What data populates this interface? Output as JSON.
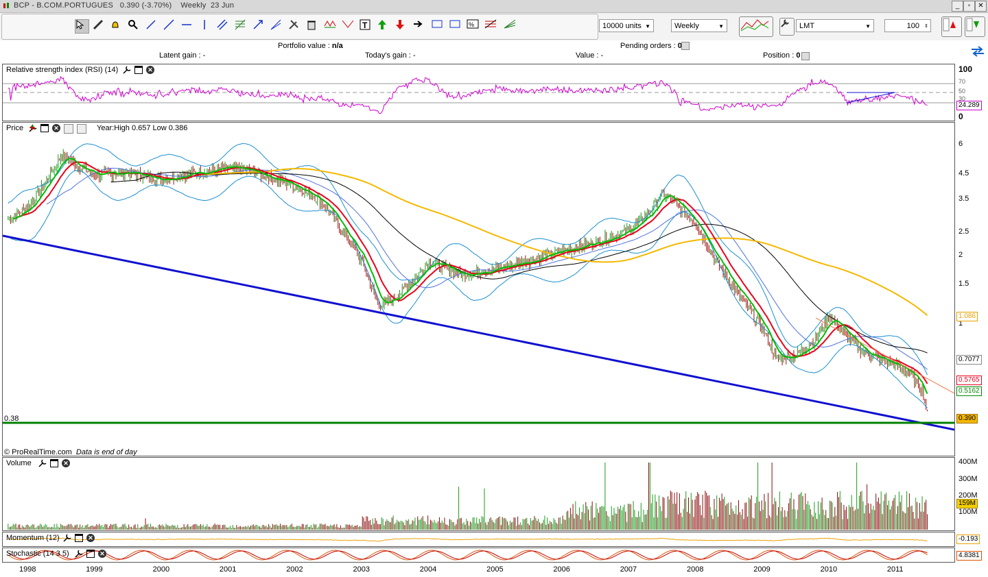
{
  "window": {
    "title": "BCP - B.COM.PORTUGUES",
    "price": "0.390",
    "change": "(-3.70%)",
    "period": "Weekly",
    "date": "23 Jun"
  },
  "toolbar": {
    "units": "10000 units",
    "timeframe": "Weekly",
    "order_type": "LMT",
    "quantity": "100"
  },
  "info": {
    "portfolio_label": "Portfolio value :",
    "portfolio_value": "n/a",
    "pending_label": "Pending orders :",
    "pending_value": "0",
    "latent_label": "Latent gain :",
    "latent_value": "-",
    "today_label": "Today's gain :",
    "today_value": "-",
    "value_label": "Value :",
    "value_value": "-",
    "position_label": "Position :",
    "position_value": "0"
  },
  "panels": {
    "rsi": {
      "title": "Relative strength index (RSI) (14)",
      "ticks": [
        "100",
        "70",
        "50",
        "30",
        "0"
      ],
      "last": "24.289"
    },
    "price": {
      "title": "Price",
      "yearinfo": "Year:High 0.657 Low 0.386",
      "ticks": [
        "6",
        "4.5",
        "3.5",
        "2.5",
        "2",
        "1.5",
        "1"
      ],
      "level_label": "0.38",
      "footer": "© ProRealTime.com",
      "footer_note": "Data is end of day",
      "tags": {
        "black_ma": "0.7077",
        "red_ma": "0.5765",
        "green_ma": "0.5162",
        "last": "0.390",
        "orange_ma": "1.086"
      }
    },
    "volume": {
      "title": "Volume",
      "ticks": [
        "400M",
        "300M",
        "200M",
        "100M"
      ],
      "last": "159M"
    },
    "momentum": {
      "title": "Momentum (12)",
      "last": "-0.193"
    },
    "stochastic": {
      "title": "Stochastic (14 3 5)",
      "last": "4.8381"
    }
  },
  "xaxis": [
    "1998",
    "1999",
    "2000",
    "2001",
    "2002",
    "2003",
    "2004",
    "2005",
    "2006",
    "2007",
    "2008",
    "2009",
    "2010",
    "2011"
  ],
  "colors": {
    "price_ma_fast": "#00bb00",
    "price_ma_mid": "#e8001c",
    "ma_long": "#f5b800",
    "ma_200": "#000000",
    "bollinger": "#1a8fd0",
    "trendline": "#1010d0",
    "support": "#008000",
    "rsi": "#d000d0"
  },
  "chart_data": [
    {
      "type": "line",
      "title": "Price",
      "scale": "log",
      "ylim": [
        0.35,
        7
      ],
      "x": [
        1997.7,
        1998.0,
        1998.25,
        1998.5,
        1998.8,
        1999.0,
        1999.5,
        2000.0,
        2000.5,
        2001.0,
        2001.3,
        2001.6,
        2002.0,
        2002.4,
        2002.7,
        2003.0,
        2003.25,
        2003.5,
        2003.8,
        2004.0,
        2004.5,
        2005.0,
        2005.5,
        2006.0,
        2006.5,
        2007.0,
        2007.3,
        2007.5,
        2007.8,
        2008.0,
        2008.3,
        2008.6,
        2009.0,
        2009.2,
        2009.5,
        2009.8,
        2010.0,
        2010.3,
        2010.5,
        2010.8,
        2011.0,
        2011.2,
        2011.4,
        2011.47
      ],
      "series": [
        {
          "values": [
            2.9,
            3.3,
            4.2,
            5.6,
            4.9,
            4.6,
            4.7,
            4.4,
            4.7,
            4.9,
            4.8,
            4.5,
            4.1,
            3.5,
            2.6,
            1.9,
            1.2,
            1.3,
            1.6,
            1.9,
            1.65,
            1.75,
            1.9,
            2.1,
            2.3,
            2.6,
            3.1,
            3.8,
            3.2,
            2.8,
            1.9,
            1.4,
            0.95,
            0.7,
            0.72,
            0.85,
            1.08,
            0.85,
            0.75,
            0.68,
            0.65,
            0.6,
            0.5,
            0.39
          ]
        }
      ],
      "annotations": [
        "0.38"
      ]
    },
    {
      "type": "line",
      "title": "Relative strength index (RSI) (14)",
      "ylim": [
        0,
        100
      ]
    },
    {
      "type": "bar",
      "title": "Volume",
      "ylim": [
        0,
        400
      ]
    }
  ]
}
